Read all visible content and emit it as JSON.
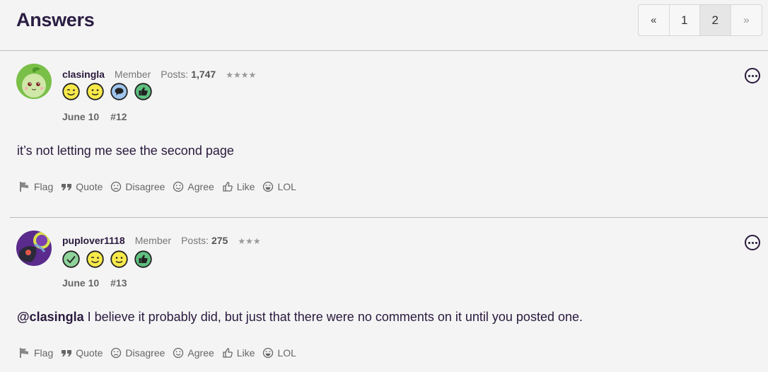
{
  "header": {
    "title": "Answers"
  },
  "pagination": {
    "prev": "«",
    "pages": [
      "1",
      "2"
    ],
    "current": "2",
    "next": "»"
  },
  "posts": [
    {
      "username": "clasingla",
      "role": "Member",
      "posts_label": "Posts:",
      "posts_count": "1,747",
      "stars": "★★★★",
      "badges": [
        "wink-badge",
        "smile-badge",
        "comment-badge",
        "thumbs-up-badge"
      ],
      "date": "June 10",
      "number": "#12",
      "body": "it’s not letting me see the second page",
      "mention": ""
    },
    {
      "username": "puplover1118",
      "role": "Member",
      "posts_label": "Posts:",
      "posts_count": "275",
      "stars": "★★★",
      "badges": [
        "check-badge",
        "wink-badge",
        "smile-badge",
        "thumbs-up-badge"
      ],
      "date": "June 10",
      "number": "#13",
      "body": " I believe it probably did, but just that there were no comments on it until you posted one.",
      "mention": "@clasingla"
    }
  ],
  "actions": {
    "flag": "Flag",
    "quote": "Quote",
    "disagree": "Disagree",
    "agree": "Agree",
    "like": "Like",
    "lol": "LOL"
  },
  "colors": {
    "text": "#2a1a3e",
    "muted": "#666666",
    "background": "#f4f4f4",
    "badge_yellow": "#f7e94a",
    "badge_blue": "#9fc6ee",
    "badge_green": "#5fbf7f"
  }
}
